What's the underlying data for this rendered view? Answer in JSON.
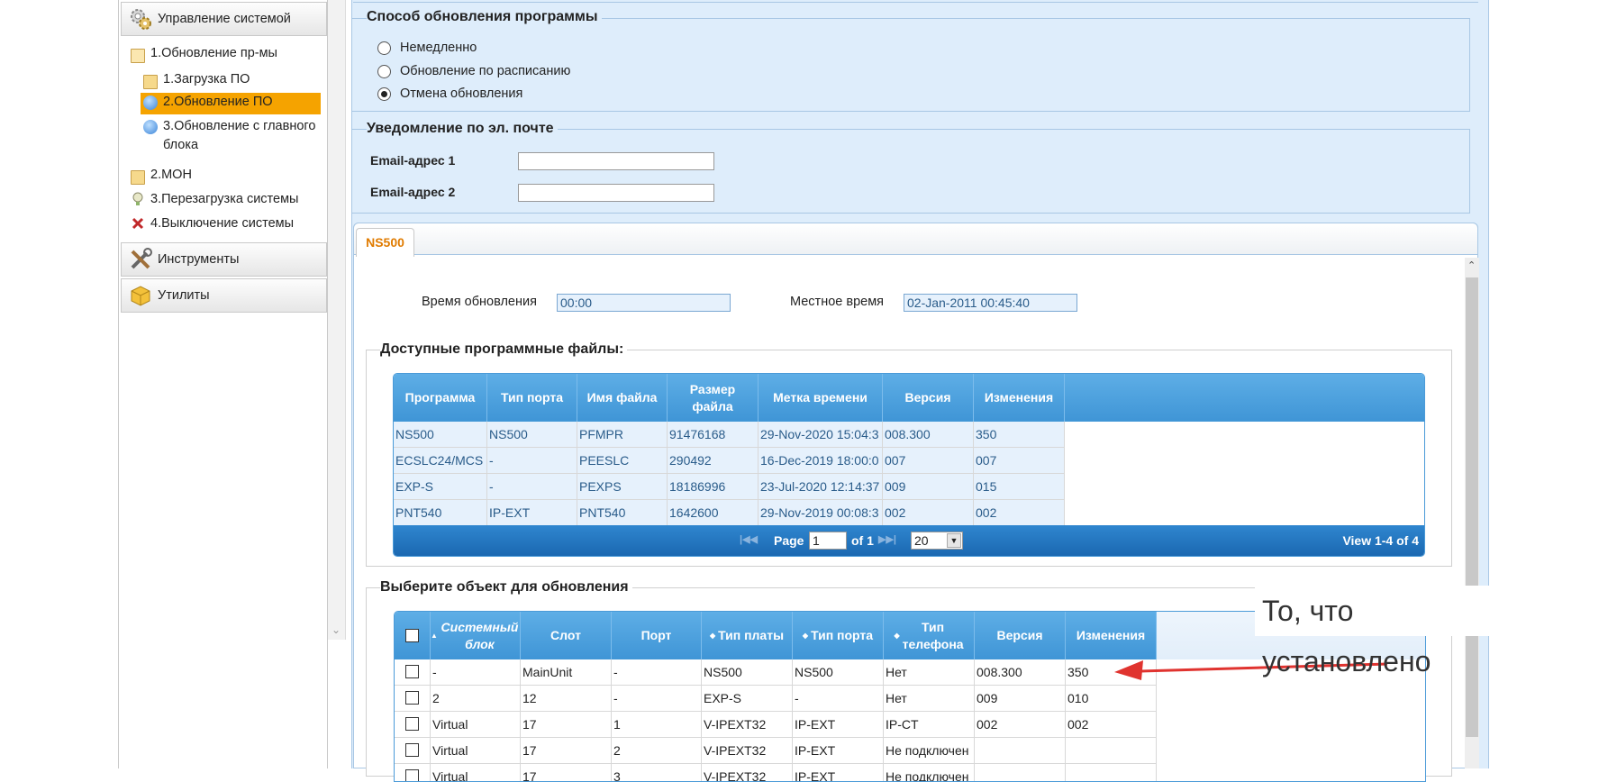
{
  "sidebar": {
    "sections": [
      {
        "label": "Управление системой",
        "icon": "gears-icon"
      },
      {
        "label": "Инструменты",
        "icon": "tools-icon"
      },
      {
        "label": "Утилиты",
        "icon": "box-icon"
      }
    ],
    "items": [
      {
        "label": "1.Обновление пр-мы",
        "icon": "folder-open-icon"
      },
      {
        "label": "1.Загрузка ПО",
        "icon": "folder-icon"
      },
      {
        "label": "2.Обновление ПО",
        "icon": "info-icon",
        "selected": true
      },
      {
        "label": "3.Обновление с главного блока",
        "icon": "info-icon"
      },
      {
        "label": "2.МОН",
        "icon": "folder-icon"
      },
      {
        "label": "3.Перезагрузка системы",
        "icon": "bulb-icon"
      },
      {
        "label": "4.Выключение системы",
        "icon": "close-icon"
      }
    ]
  },
  "update_method": {
    "title": "Способ обновления программы",
    "options": [
      "Немедленно",
      "Обновление по расписанию",
      "Отмена обновления"
    ],
    "selected": "Отмена обновления"
  },
  "email": {
    "title": "Уведомление по эл. почте",
    "fields": [
      {
        "label": "Email-адрес 1",
        "value": ""
      },
      {
        "label": "Email-адрес 2",
        "value": ""
      }
    ]
  },
  "tab": {
    "label": "NS500"
  },
  "times": {
    "update_label": "Время обновления",
    "update_value": "00:00",
    "local_label": "Местное время",
    "local_value": "02-Jan-2011 00:45:40"
  },
  "available": {
    "title": "Доступные программные файлы:",
    "columns": [
      "Программа",
      "Тип порта",
      "Имя файла",
      "Размер файла",
      "Метка времени",
      "Версия",
      "Изменения"
    ],
    "rows": [
      [
        "NS500",
        "NS500",
        "PFMPR",
        "91476168",
        "29-Nov-2020 15:04:3",
        "008.300",
        "350"
      ],
      [
        "ECSLC24/MCS",
        "-",
        "PEESLC",
        "290492",
        "16-Dec-2019 18:00:0",
        "007",
        "007"
      ],
      [
        "EXP-S",
        "-",
        "PEXPS",
        "18186996",
        "23-Jul-2020 12:14:37",
        "009",
        "015"
      ],
      [
        "PNT540",
        "IP-EXT",
        "PNT540",
        "1642600",
        "29-Nov-2019 00:08:3",
        "002",
        "002"
      ]
    ],
    "pager": {
      "page_label": "Page",
      "page": "1",
      "of_label": "of 1",
      "per_page": "20",
      "view": "View 1-4 of 4"
    }
  },
  "targets": {
    "title": "Выберите объект для обновления",
    "columns": [
      "Системный блок",
      "Слот",
      "Порт",
      "Тип платы",
      "Тип порта",
      "Тип телефона",
      "Версия",
      "Изменения"
    ],
    "rows": [
      [
        "-",
        "MainUnit",
        "-",
        "NS500",
        "NS500",
        "Нет",
        "008.300",
        "350"
      ],
      [
        "2",
        "12",
        "-",
        "EXP-S",
        "-",
        "Нет",
        "009",
        "010"
      ],
      [
        "Virtual",
        "17",
        "1",
        "V-IPEXT32",
        "IP-EXT",
        "IP-CT",
        "002",
        "002"
      ],
      [
        "Virtual",
        "17",
        "2",
        "V-IPEXT32",
        "IP-EXT",
        "Не подключен",
        "",
        ""
      ],
      [
        "Virtual",
        "17",
        "3",
        "V-IPEXT32",
        "IP-EXT",
        "Не подключен",
        "",
        ""
      ]
    ]
  },
  "annotation": {
    "text": "То, что установлено",
    "color": "#e0332f"
  }
}
